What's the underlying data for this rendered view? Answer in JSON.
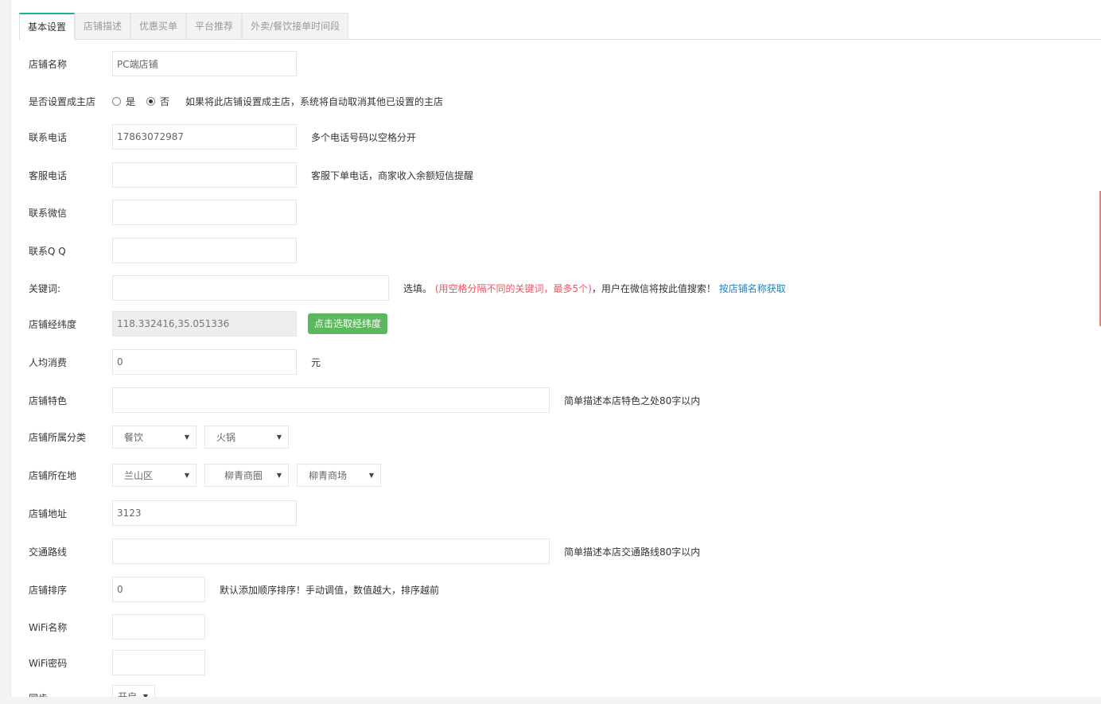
{
  "tabs": [
    "基本设置",
    "店铺描述",
    "优惠买单",
    "平台推荐",
    "外卖/餐饮接单时间段"
  ],
  "form": {
    "shop_name": {
      "label": "店铺名称",
      "value": "PC端店铺"
    },
    "main_store": {
      "label": "是否设置成主店",
      "yes": "是",
      "no": "否",
      "selected": "否",
      "help": "如果将此店铺设置成主店，系统将自动取消其他已设置的主店"
    },
    "phone": {
      "label": "联系电话",
      "value": "17863072987",
      "help": "多个电话号码以空格分开"
    },
    "service_phone": {
      "label": "客服电话",
      "value": "",
      "help": "客服下单电话，商家收入余额短信提醒"
    },
    "wechat": {
      "label": "联系微信",
      "value": ""
    },
    "qq": {
      "label": "联系Q Q",
      "value": ""
    },
    "keywords": {
      "label": "关键词:",
      "value": "",
      "help_prefix": "选填。",
      "help_red": "(用空格分隔不同的关键词，最多5个)",
      "help_suffix": "，用户在微信将按此值搜索！",
      "help_link": "按店铺名称获取"
    },
    "lnglat": {
      "label": "店铺经纬度",
      "value": "118.332416,35.051336",
      "button": "点击选取经纬度"
    },
    "avg_cost": {
      "label": "人均消费",
      "value": "0",
      "unit": "元"
    },
    "feature": {
      "label": "店铺特色",
      "value": "",
      "help": "简单描述本店特色之处80字以内"
    },
    "category": {
      "label": "店铺所属分类",
      "cat1": "餐饮",
      "cat2": "火锅"
    },
    "location": {
      "label": "店铺所在地",
      "area": "兰山区",
      "circle": "柳青商圈",
      "market": "柳青商场"
    },
    "address": {
      "label": "店铺地址",
      "value": "3123"
    },
    "traffic": {
      "label": "交通路线",
      "value": "",
      "help": "简单描述本店交通路线80字以内"
    },
    "sort": {
      "label": "店铺排序",
      "value": "0",
      "help": "默认添加顺序排序！手动调值，数值越大，排序越前"
    },
    "wifi_name": {
      "label": "WiFi名称",
      "value": ""
    },
    "wifi_pass": {
      "label": "WiFi密码",
      "value": ""
    },
    "partial": {
      "label": "同步",
      "value": "开启"
    }
  },
  "colors": {
    "tab_active_top": "#1ab394",
    "button_green": "#5cb85c",
    "red_text": "#ed5565",
    "link": "#1c84c6"
  }
}
